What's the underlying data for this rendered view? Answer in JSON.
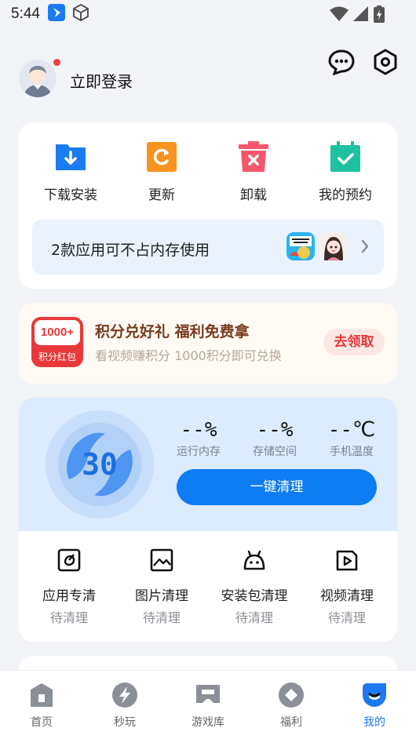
{
  "status_bar": {
    "time": "5:44",
    "icons": [
      "app-notification-icon",
      "box-icon",
      "wifi-icon",
      "signal-icon",
      "battery-icon"
    ]
  },
  "header": {
    "login_text": "立即登录",
    "icons": [
      "message-icon",
      "settings-icon"
    ]
  },
  "quick_actions": [
    {
      "label": "下载安装",
      "icon": "download-icon",
      "color": "#1a7cf0"
    },
    {
      "label": "更新",
      "icon": "update-icon",
      "color": "#f7931e"
    },
    {
      "label": "卸载",
      "icon": "uninstall-icon",
      "color": "#f4586c"
    },
    {
      "label": "我的预约",
      "icon": "calendar-check-icon",
      "color": "#1fc0a0"
    }
  ],
  "free_storage_banner": {
    "text": "2款应用可不占内存使用"
  },
  "points_banner": {
    "badge_value": "1000+",
    "badge_label": "积分红包",
    "title": "积分兑好礼 福利免费拿",
    "subtitle": "看视频赚积分 1000积分即可兑换",
    "button": "去领取"
  },
  "cleaner": {
    "score": "30",
    "stats": [
      {
        "value": "--%",
        "label": "运行内存"
      },
      {
        "value": "--%",
        "label": "存储空间"
      },
      {
        "value": "--℃",
        "label": "手机温度"
      }
    ],
    "button": "一键清理",
    "tools": [
      {
        "name": "应用专清",
        "status": "待清理",
        "icon": "app-clean-icon"
      },
      {
        "name": "图片清理",
        "status": "待清理",
        "icon": "image-icon"
      },
      {
        "name": "安装包清理",
        "status": "待清理",
        "icon": "android-icon"
      },
      {
        "name": "视频清理",
        "status": "待清理",
        "icon": "video-icon"
      }
    ]
  },
  "tabs": [
    {
      "label": "首页",
      "icon": "home-icon",
      "active": false
    },
    {
      "label": "秒玩",
      "icon": "lightning-icon",
      "active": false
    },
    {
      "label": "游戏库",
      "icon": "game-library-icon",
      "active": false
    },
    {
      "label": "福利",
      "icon": "gift-icon",
      "active": false
    },
    {
      "label": "我的",
      "icon": "profile-icon",
      "active": true
    }
  ],
  "colors": {
    "accent": "#0e7cf2",
    "points_red": "#e8383a",
    "points_title": "#7a3b1e"
  }
}
